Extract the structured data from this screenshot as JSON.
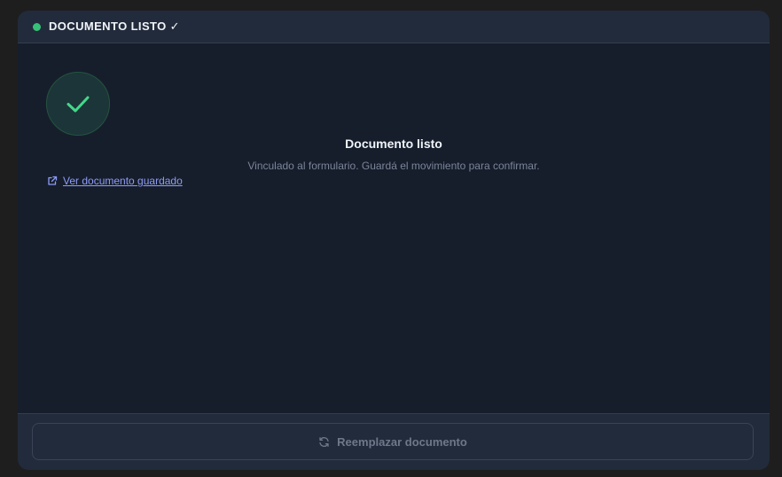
{
  "header": {
    "title": "DOCUMENTO LISTO ✓",
    "status_color": "#35c278"
  },
  "main": {
    "status_icon": "check-icon",
    "title": "Documento listo",
    "subtitle": "Vinculado al formulario. Guardá el movimiento para confirmar.",
    "link": {
      "icon": "external-link-icon",
      "label": "Ver documento guardado"
    }
  },
  "footer": {
    "button": {
      "icon": "refresh-icon",
      "label": "Reemplazar documento"
    }
  },
  "colors": {
    "accent_green": "#35c278",
    "link": "#8e9cf6",
    "background": "#161e2c"
  }
}
